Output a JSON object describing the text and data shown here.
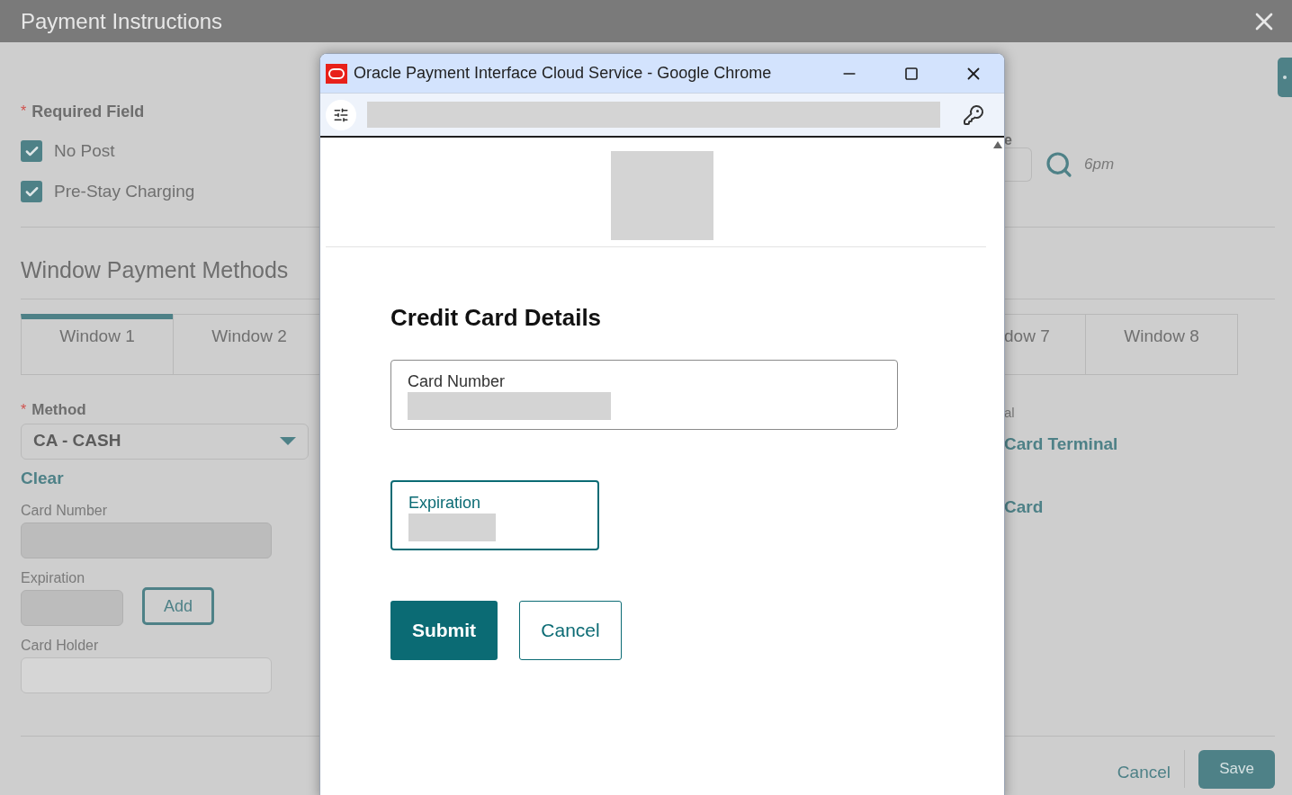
{
  "page": {
    "title": "Payment Instructions"
  },
  "required_note": {
    "marker": "*",
    "text": "Required Field"
  },
  "options": [
    {
      "label": "No Post",
      "checked": true
    },
    {
      "label": "Pre-Stay Charging",
      "checked": true
    }
  ],
  "right_field": {
    "label": "e",
    "hint": "6pm"
  },
  "section_title": "Window Payment Methods",
  "tabs_left": [
    {
      "label": "Window 1",
      "selected": true
    },
    {
      "label": "Window 2",
      "selected": false
    }
  ],
  "tabs_right": [
    {
      "label": "dow 7",
      "selected": false
    },
    {
      "label": "Window 8",
      "selected": false
    }
  ],
  "method": {
    "marker": "*",
    "label": "Method",
    "value": "CA - CASH"
  },
  "clear_link": "Clear",
  "fields": [
    {
      "label": "Card Number",
      "disabled": true
    },
    {
      "label": "Expiration",
      "disabled": true
    },
    {
      "label": "Card Holder",
      "disabled": false
    }
  ],
  "add_button": "Add",
  "right_column": {
    "label": "al",
    "links": [
      "Card Terminal",
      "Card"
    ]
  },
  "footer": {
    "cancel": "Cancel",
    "save": "Save"
  },
  "popup": {
    "title": "Oracle Payment Interface Cloud Service - Google Chrome",
    "heading": "Credit Card Details",
    "fields": [
      {
        "label": "Card Number",
        "focused": false
      },
      {
        "label": "Expiration",
        "focused": true
      }
    ],
    "buttons": [
      {
        "label": "Submit",
        "kind": "primary"
      },
      {
        "label": "Cancel",
        "kind": "secondary"
      }
    ]
  }
}
